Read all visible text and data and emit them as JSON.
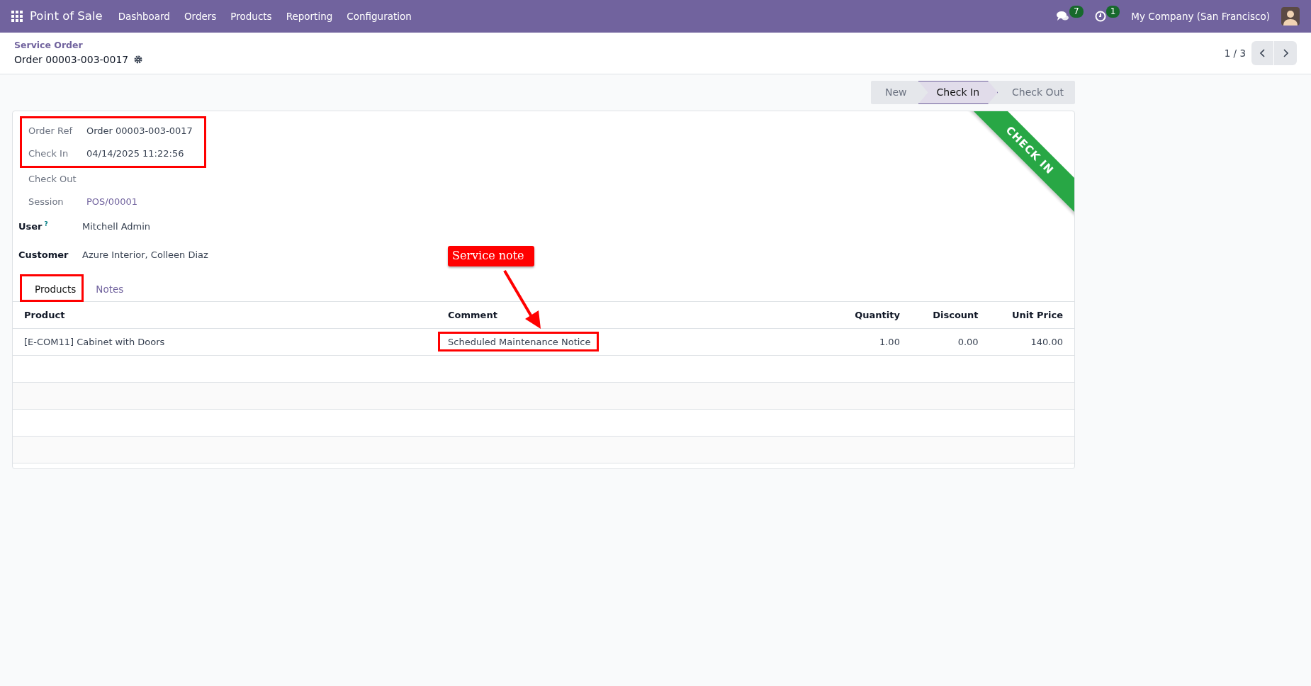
{
  "navbar": {
    "app_name": "Point of Sale",
    "menu": [
      "Dashboard",
      "Orders",
      "Products",
      "Reporting",
      "Configuration"
    ],
    "messages_count": "7",
    "activities_count": "1",
    "company": "My Company (San Francisco)"
  },
  "control_panel": {
    "breadcrumb": "Service Order",
    "record_title": "Order 00003-003-0017",
    "pager": "1 / 3"
  },
  "statusbar": [
    {
      "label": "New",
      "selected": false
    },
    {
      "label": "Check In",
      "selected": true
    },
    {
      "label": "Check Out",
      "selected": false
    }
  ],
  "ribbon": "CHECK IN",
  "fields": [
    {
      "label": "Order Ref",
      "value": "Order 00003-003-0017",
      "kind": "text",
      "bold_label": false,
      "highlighted": true
    },
    {
      "label": "Check In",
      "value": "04/14/2025 11:22:56",
      "kind": "text",
      "bold_label": false,
      "highlighted": true
    },
    {
      "label": "Check Out",
      "kind": "text",
      "bold_label": false,
      "highlighted": false
    },
    {
      "label": "Session",
      "value": "POS/00001",
      "kind": "link",
      "bold_label": false,
      "highlighted": false
    },
    {
      "label": "User",
      "help": "?",
      "value": "Mitchell Admin",
      "kind": "text",
      "bold_label": true,
      "highlighted": false
    },
    {
      "label": "Customer",
      "value": "Azure Interior, Colleen Diaz",
      "kind": "text",
      "bold_label": true,
      "highlighted": false
    }
  ],
  "tabs": [
    {
      "label": "Products",
      "selected": true,
      "highlighted": true
    },
    {
      "label": "Notes",
      "selected": false,
      "highlighted": false
    }
  ],
  "table": {
    "columns": [
      "Product",
      "Comment",
      "Quantity",
      "Discount",
      "Unit Price"
    ],
    "rows": [
      {
        "cells": [
          "[E-COM11] Cabinet with Doors",
          "Scheduled Maintenance Notice",
          "1.00",
          "0.00",
          "140.00"
        ],
        "comment_highlighted": true
      }
    ]
  },
  "annotation": {
    "callout": "Service note"
  }
}
